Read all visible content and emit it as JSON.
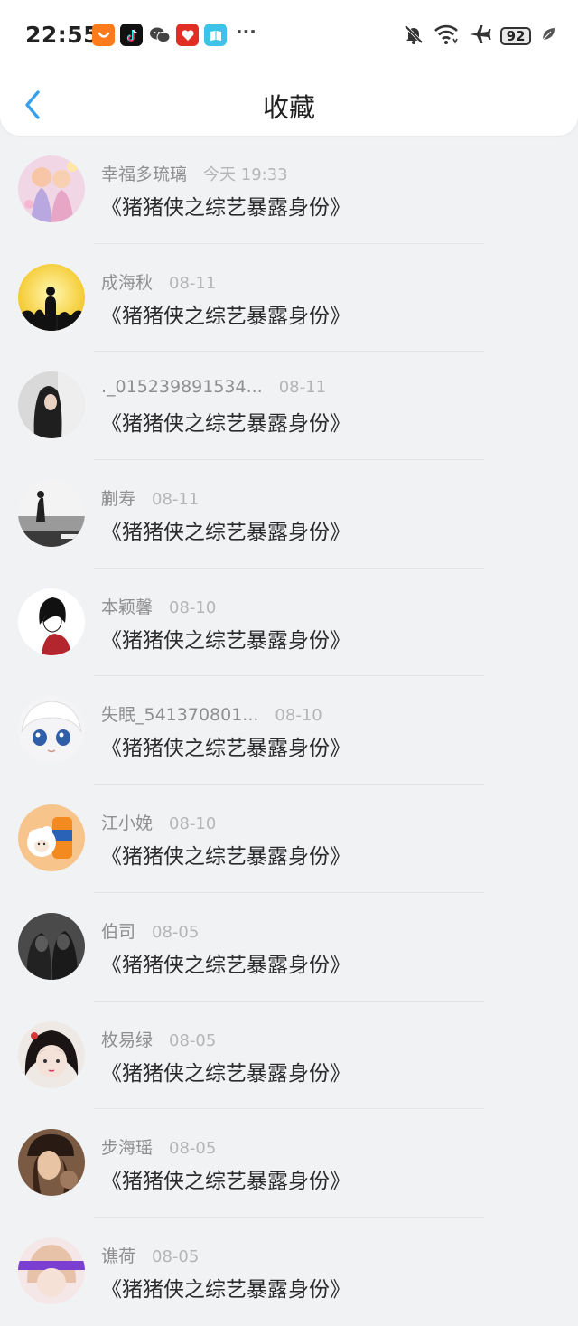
{
  "status_bar": {
    "time": "22:55",
    "battery": "92",
    "app_icons": [
      "taobao-icon",
      "tiktok-icon",
      "wechat-icon",
      "pinduoduo-icon",
      "reader-icon"
    ],
    "more": "···"
  },
  "header": {
    "title": "收藏"
  },
  "colors": {
    "accent": "#3aa0ea",
    "background": "#f1f2f4"
  },
  "items": [
    {
      "username": "幸福多琉璃",
      "date": "今天 19:33",
      "title": "《猪猪侠之综艺暴露身份》"
    },
    {
      "username": "成海秋",
      "date": "08-11",
      "title": "《猪猪侠之综艺暴露身份》"
    },
    {
      "username": "._015239891534...",
      "date": "08-11",
      "title": "《猪猪侠之综艺暴露身份》"
    },
    {
      "username": "蒯寿",
      "date": "08-11",
      "title": "《猪猪侠之综艺暴露身份》"
    },
    {
      "username": "本颖馨",
      "date": "08-10",
      "title": "《猪猪侠之综艺暴露身份》"
    },
    {
      "username": "失眠_541370801...",
      "date": "08-10",
      "title": "《猪猪侠之综艺暴露身份》"
    },
    {
      "username": "江小娩",
      "date": "08-10",
      "title": "《猪猪侠之综艺暴露身份》"
    },
    {
      "username": "伯司",
      "date": "08-05",
      "title": "《猪猪侠之综艺暴露身份》"
    },
    {
      "username": "枚易绿",
      "date": "08-05",
      "title": "《猪猪侠之综艺暴露身份》"
    },
    {
      "username": "步海瑶",
      "date": "08-05",
      "title": "《猪猪侠之综艺暴露身份》"
    },
    {
      "username": "谯荷",
      "date": "08-05",
      "title": "《猪猪侠之综艺暴露身份》"
    }
  ]
}
